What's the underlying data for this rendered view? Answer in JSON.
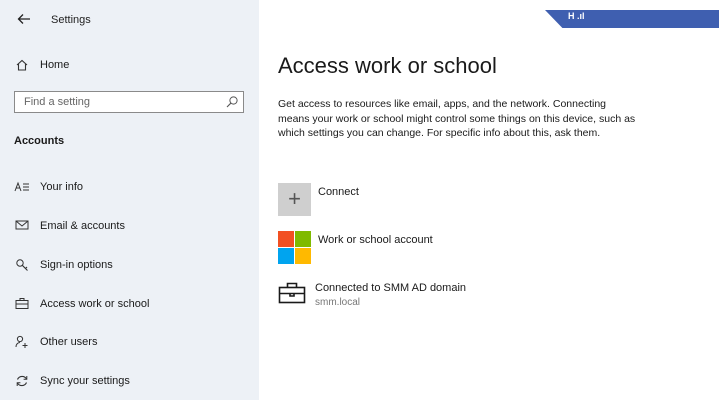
{
  "window": {
    "app_title": "Settings",
    "strip_text": "H .ıl"
  },
  "sidebar": {
    "home_label": "Home",
    "search": {
      "placeholder": "Find a setting"
    },
    "section_title": "Accounts",
    "items": [
      {
        "label": "Your info",
        "icon": "person-card-icon"
      },
      {
        "label": "Email & accounts",
        "icon": "mail-icon"
      },
      {
        "label": "Sign-in options",
        "icon": "key-icon"
      },
      {
        "label": "Access work or school",
        "icon": "briefcase-icon"
      },
      {
        "label": "Other users",
        "icon": "person-add-icon"
      },
      {
        "label": "Sync your settings",
        "icon": "sync-icon"
      }
    ]
  },
  "main": {
    "title": "Access work or school",
    "description": "Get access to resources like email, apps, and the network. Connecting means your work or school might control some things on this device, such as which settings you can change. For specific info about this, ask them.",
    "connect": {
      "label": "Connect",
      "icon": "plus-icon"
    },
    "work_account": {
      "label": "Work or school account",
      "icon": "microsoft-logo-icon"
    },
    "domain": {
      "label": "Connected to SMM AD domain",
      "sub": "smm.local",
      "icon": "briefcase-icon"
    }
  },
  "colors": {
    "sidebar_bg": "#edf1f6",
    "accent_strip": "#3f5fb0",
    "ms_red": "#f25022",
    "ms_green": "#7fba00",
    "ms_blue": "#00a4ef",
    "ms_yellow": "#ffb900"
  }
}
